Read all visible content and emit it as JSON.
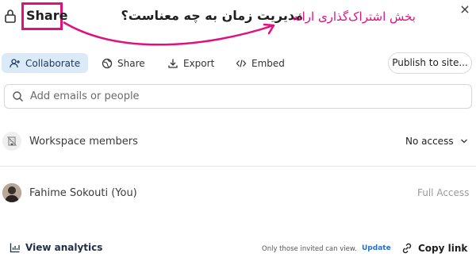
{
  "header": {
    "title": "Share",
    "title_annotation": "مدیریت زمان به چه معناست؟",
    "section_annotation": "بخش اشتراک‌گذاری ارائه",
    "close_label": "×"
  },
  "tabs": [
    {
      "label": "Collaborate",
      "icon": "add-user-icon",
      "active": true
    },
    {
      "label": "Share",
      "icon": "globe-icon",
      "active": false
    },
    {
      "label": "Export",
      "icon": "download-icon",
      "active": false
    },
    {
      "label": "Embed",
      "icon": "code-icon",
      "active": false
    }
  ],
  "publish_label": "Publish to site...",
  "search": {
    "placeholder": "Add emails or people",
    "value": ""
  },
  "workspace": {
    "label": "Workspace members",
    "access": "No access"
  },
  "user": {
    "name": "Fahime Sokouti (You)",
    "access": "Full Access"
  },
  "footer": {
    "analytics_label": "View analytics",
    "invite_note": "Only those invited can view.",
    "update_label": "Update",
    "copy_link_label": "Copy link"
  },
  "colors": {
    "annotation": "#e0117f",
    "active_tab_bg": "#dbeaf8",
    "link": "#2a6fc9"
  }
}
